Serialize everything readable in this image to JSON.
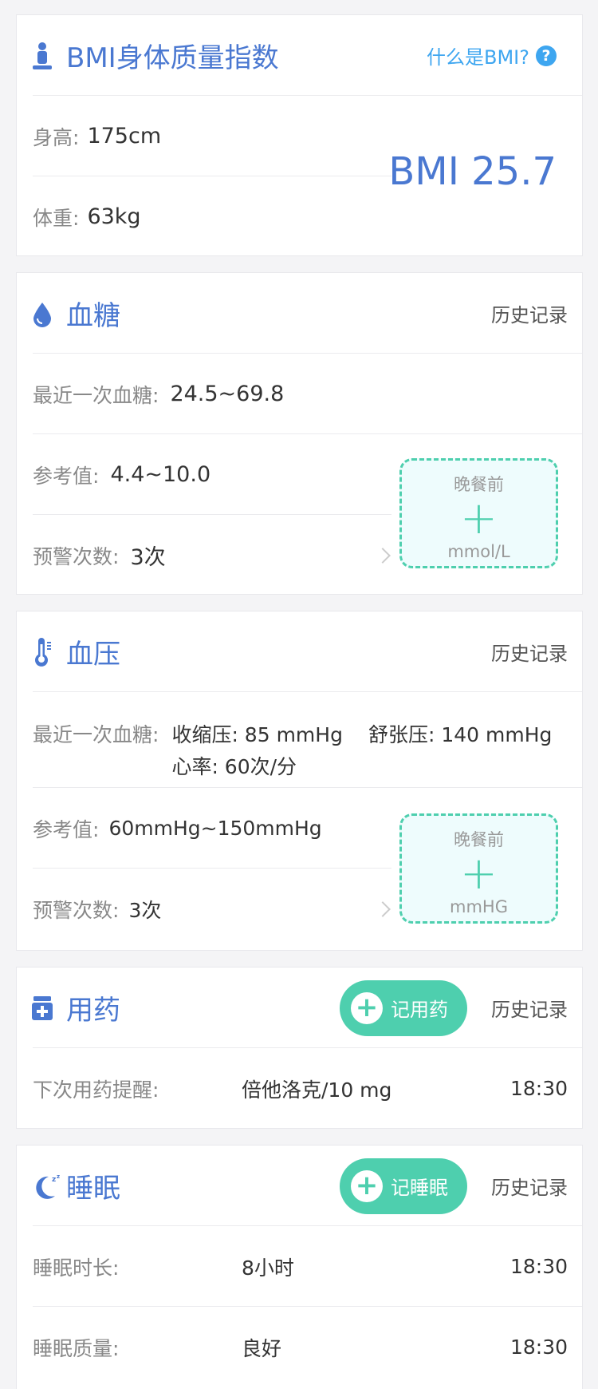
{
  "bmi": {
    "title": "BMI身体质量指数",
    "what_is": "什么是BMI?",
    "height_label": "身高:",
    "height_value": "175cm",
    "weight_label": "体重:",
    "weight_value": "63kg",
    "bmi_value": "BMI 25.7"
  },
  "glucose": {
    "title": "血糖",
    "history": "历史记录",
    "recent_label": "最近一次血糖:",
    "recent_value": "24.5~69.8",
    "ref_label": "参考值:",
    "ref_value": "4.4~10.0",
    "warn_label": "预警次数:",
    "warn_value": "3次",
    "add_title": "晚餐前",
    "add_unit": "mmol/L"
  },
  "pressure": {
    "title": "血压",
    "history": "历史记录",
    "recent_label": "最近一次血糖:",
    "systolic": "收缩压: 85 mmHg",
    "diastolic": "舒张压: 140 mmHg",
    "heart_rate": "心率: 60次/分",
    "ref_label": "参考值:",
    "ref_value": "60mmHg~150mmHg",
    "warn_label": "预警次数:",
    "warn_value": "3次",
    "add_title": "晚餐前",
    "add_unit": "mmHG"
  },
  "medication": {
    "title": "用药",
    "add_button": "记用药",
    "history": "历史记录",
    "next_label": "下次用药提醒:",
    "next_drug": "倍他洛克/10 mg",
    "next_time": "18:30"
  },
  "sleep": {
    "title": "睡眠",
    "add_button": "记睡眠",
    "history": "历史记录",
    "duration_label": "睡眠时长:",
    "duration_value": "8小时",
    "duration_time": "18:30",
    "quality_label": "睡眠质量:",
    "quality_value": "良好",
    "quality_time": "18:30"
  },
  "colors": {
    "accent_blue": "#4a78d1",
    "accent_green": "#4ecfae",
    "help_blue": "#3ea6f0"
  },
  "icons": [
    "person-icon",
    "help-circle-icon",
    "drop-icon",
    "thermometer-icon",
    "medicine-box-icon",
    "moon-sleep-icon",
    "plus-icon",
    "chevron-right-icon"
  ]
}
